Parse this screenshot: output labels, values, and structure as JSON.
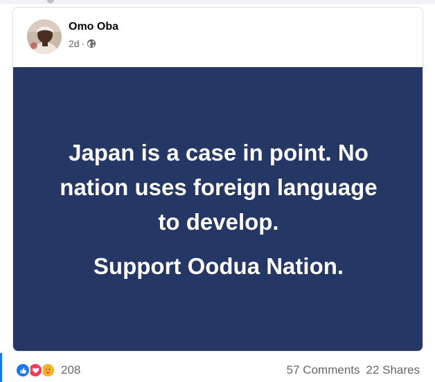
{
  "post": {
    "author": "Omo Oba",
    "time": "2d",
    "separator": "·",
    "privacy_icon": "globe-icon",
    "background_color": "#253765",
    "text_lines": [
      "Japan is a case in point. No",
      "nation uses foreign language",
      "to develop."
    ],
    "cta": "Support Oodua Nation."
  },
  "footer": {
    "reaction_icons": [
      "like-icon",
      "love-icon",
      "care-icon"
    ],
    "reaction_count": "208",
    "comments": "57 Comments",
    "shares": "22 Shares"
  },
  "colors": {
    "accent": "#1877f2",
    "love": "#f33e58",
    "care": "#f7b125"
  }
}
